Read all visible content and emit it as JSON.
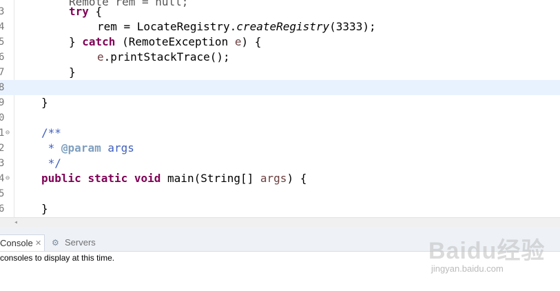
{
  "editor": {
    "cut_top": "Remote rem = null;",
    "lines": [
      {
        "num": "3",
        "t0": "try",
        "t1": " {"
      },
      {
        "num": "4",
        "t0": "rem = LocateRegistry.",
        "t1": "createRegistry",
        "t2": "(3333);"
      },
      {
        "num": "5",
        "t0": "} ",
        "t1": "catch",
        "t2": " (RemoteException ",
        "t3": "e",
        "t4": ") {"
      },
      {
        "num": "6",
        "t0": "e",
        "t1": ".printStackTrace();"
      },
      {
        "num": "7",
        "t0": "}"
      },
      {
        "num": "8"
      },
      {
        "num": "9",
        "t0": "}"
      },
      {
        "num": "0"
      },
      {
        "num": "1",
        "t0": "/**"
      },
      {
        "num": "2",
        "t0": " * ",
        "t1": "@param",
        "t2": " args"
      },
      {
        "num": "3",
        "t0": " */"
      },
      {
        "num": "4",
        "t0": "public",
        "t1": " ",
        "t2": "static",
        "t3": " ",
        "t4": "void",
        "t5": " main(String[] ",
        "t6": "args",
        "t7": ") {"
      },
      {
        "num": "5"
      },
      {
        "num": "6",
        "t0": "}"
      }
    ],
    "fold_icon": "⊖"
  },
  "scrollbar": {
    "arrow": "◂"
  },
  "panel": {
    "tabs": [
      {
        "label": "Console",
        "close": "✕"
      },
      {
        "label": "Servers",
        "icon": "servers-icon",
        "glyph": "⚙"
      }
    ],
    "message": "consoles to display at this time."
  },
  "watermark": {
    "main": "Baidu经验",
    "sub": "jingyan.baidu.com"
  },
  "colors": {
    "keyword": "#7f0055",
    "javadoc": "#3f5fbf",
    "javadoc_tag": "#7f9fbf",
    "local_var": "#6a3e3e",
    "current_line": "#e8f2fe"
  }
}
